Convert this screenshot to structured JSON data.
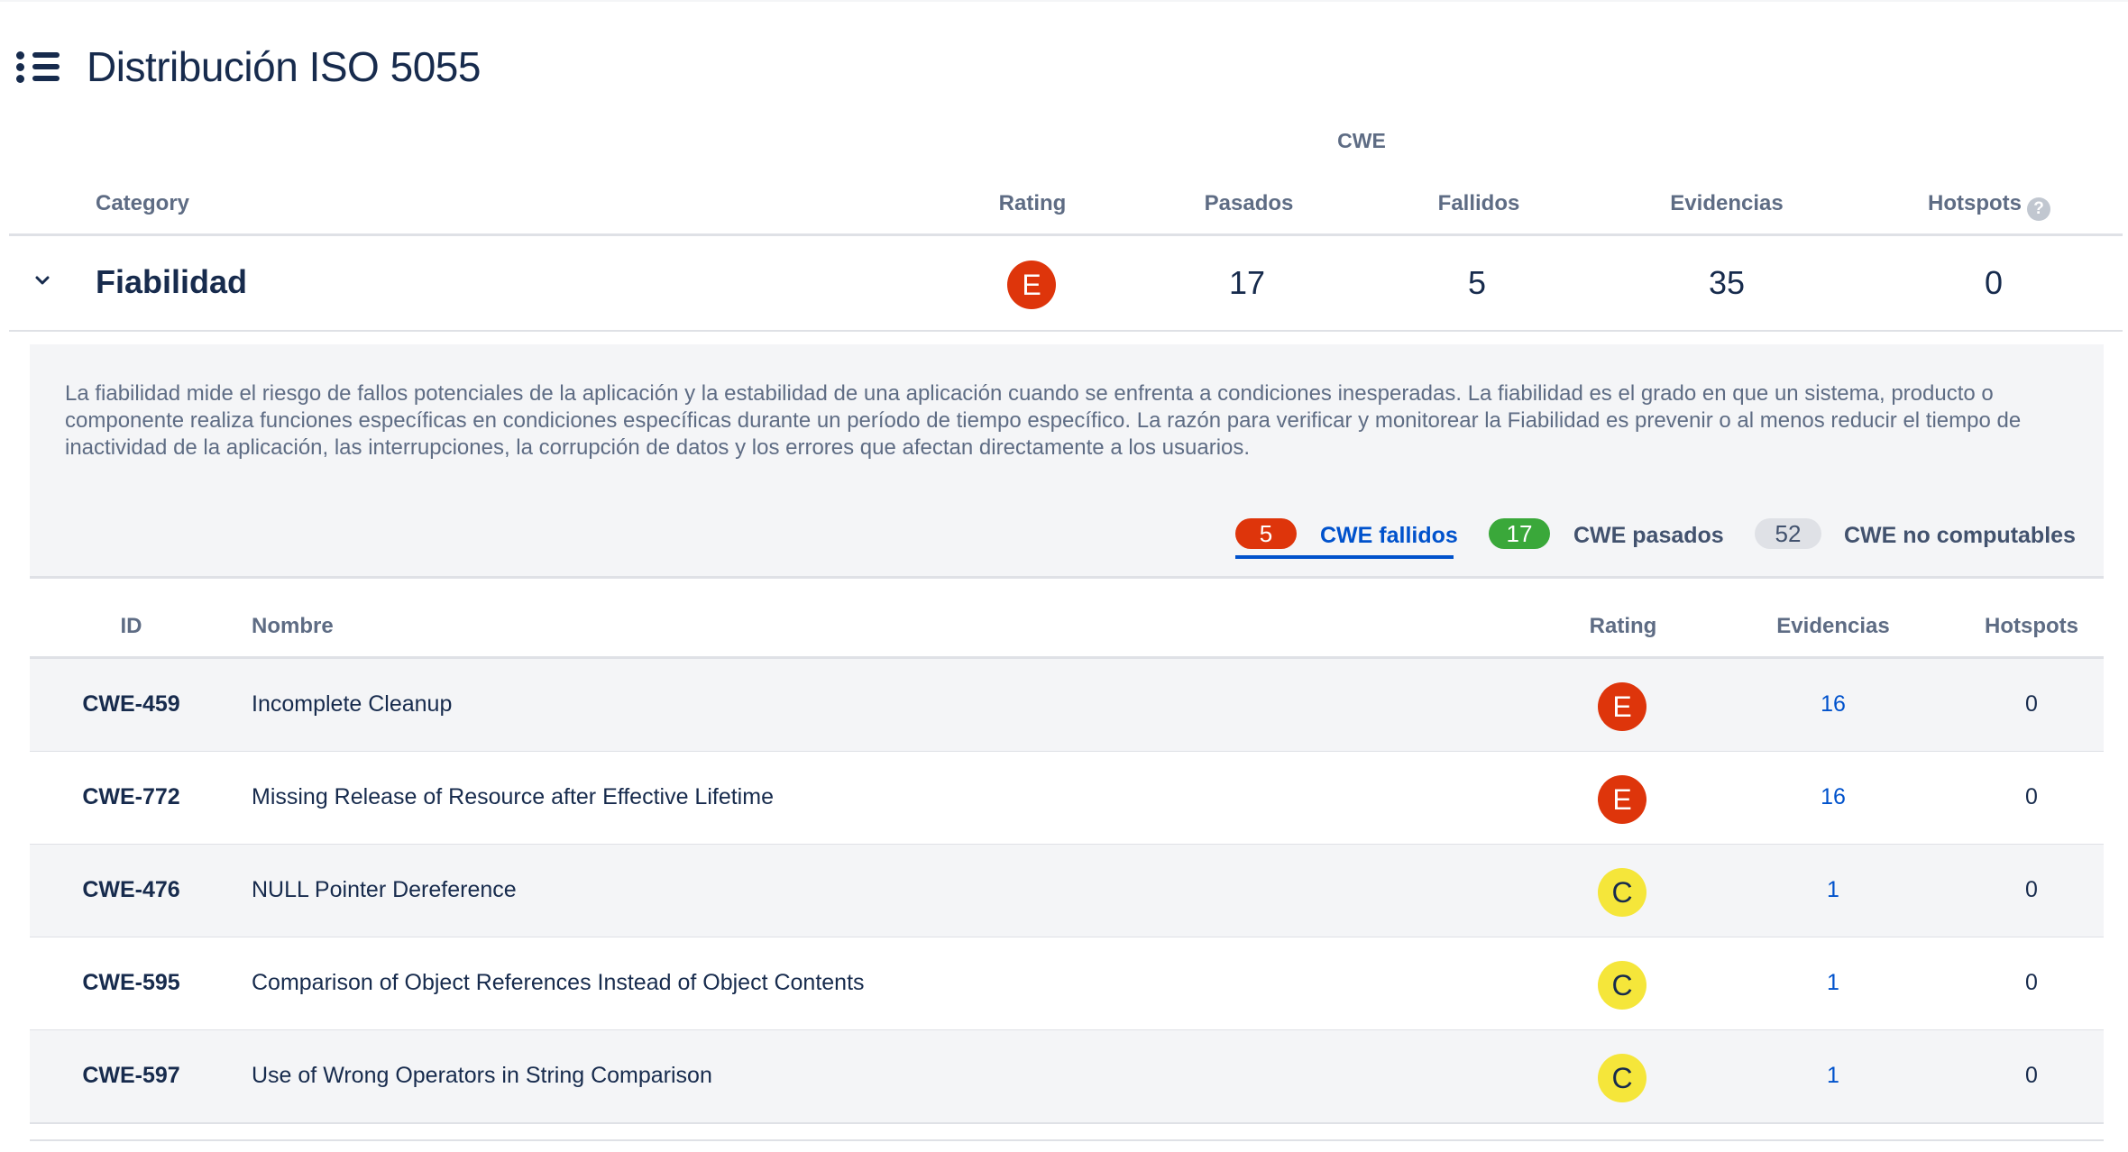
{
  "page": {
    "title": "Distribución ISO 5055"
  },
  "summary_header": {
    "cwe_group": "CWE",
    "category": "Category",
    "rating": "Rating",
    "pasados": "Pasados",
    "fallidos": "Fallidos",
    "evidencias": "Evidencias",
    "hotspots": "Hotspots",
    "help_icon": "?"
  },
  "category": {
    "name": "Fiabilidad",
    "rating": "E",
    "pasados": "17",
    "fallidos": "5",
    "evidencias": "35",
    "hotspots": "0",
    "description": "La fiabilidad mide el riesgo de fallos potenciales de la aplicación y la estabilidad de una aplicación cuando se enfrenta a condiciones inesperadas. La fiabilidad es el grado en que un sistema, producto o componente realiza funciones específicas en condiciones específicas durante un período de tiempo específico. La razón para verificar y monitorear la Fiabilidad es prevenir o al menos reducir el tiempo de inactividad de la aplicación, las interrupciones, la corrupción de datos y los errores que afectan directamente a los usuarios."
  },
  "tabs": [
    {
      "count": "5",
      "label": "CWE fallidos",
      "active": true,
      "color": "#de350b"
    },
    {
      "count": "17",
      "label": "CWE pasados",
      "active": false,
      "color": "#3aa83a"
    },
    {
      "count": "52",
      "label": "CWE no computables",
      "active": false,
      "color": "#dfe1e6"
    }
  ],
  "table": {
    "headers": {
      "id": "ID",
      "nombre": "Nombre",
      "rating": "Rating",
      "evidencias": "Evidencias",
      "hotspots": "Hotspots"
    },
    "rows": [
      {
        "id": "CWE-459",
        "nombre": "Incomplete Cleanup",
        "rating": "E",
        "evidencias": "16",
        "hotspots": "0"
      },
      {
        "id": "CWE-772",
        "nombre": "Missing Release of Resource after Effective Lifetime",
        "rating": "E",
        "evidencias": "16",
        "hotspots": "0"
      },
      {
        "id": "CWE-476",
        "nombre": "NULL Pointer Dereference",
        "rating": "C",
        "evidencias": "1",
        "hotspots": "0"
      },
      {
        "id": "CWE-595",
        "nombre": "Comparison of Object References Instead of Object Contents",
        "rating": "C",
        "evidencias": "1",
        "hotspots": "0"
      },
      {
        "id": "CWE-597",
        "nombre": "Use of Wrong Operators in String Comparison",
        "rating": "C",
        "evidencias": "1",
        "hotspots": "0"
      }
    ]
  },
  "colors": {
    "rating_E": "#de350b",
    "rating_C": "#f5e63a",
    "link": "#0052cc",
    "text": "#172b4d"
  }
}
